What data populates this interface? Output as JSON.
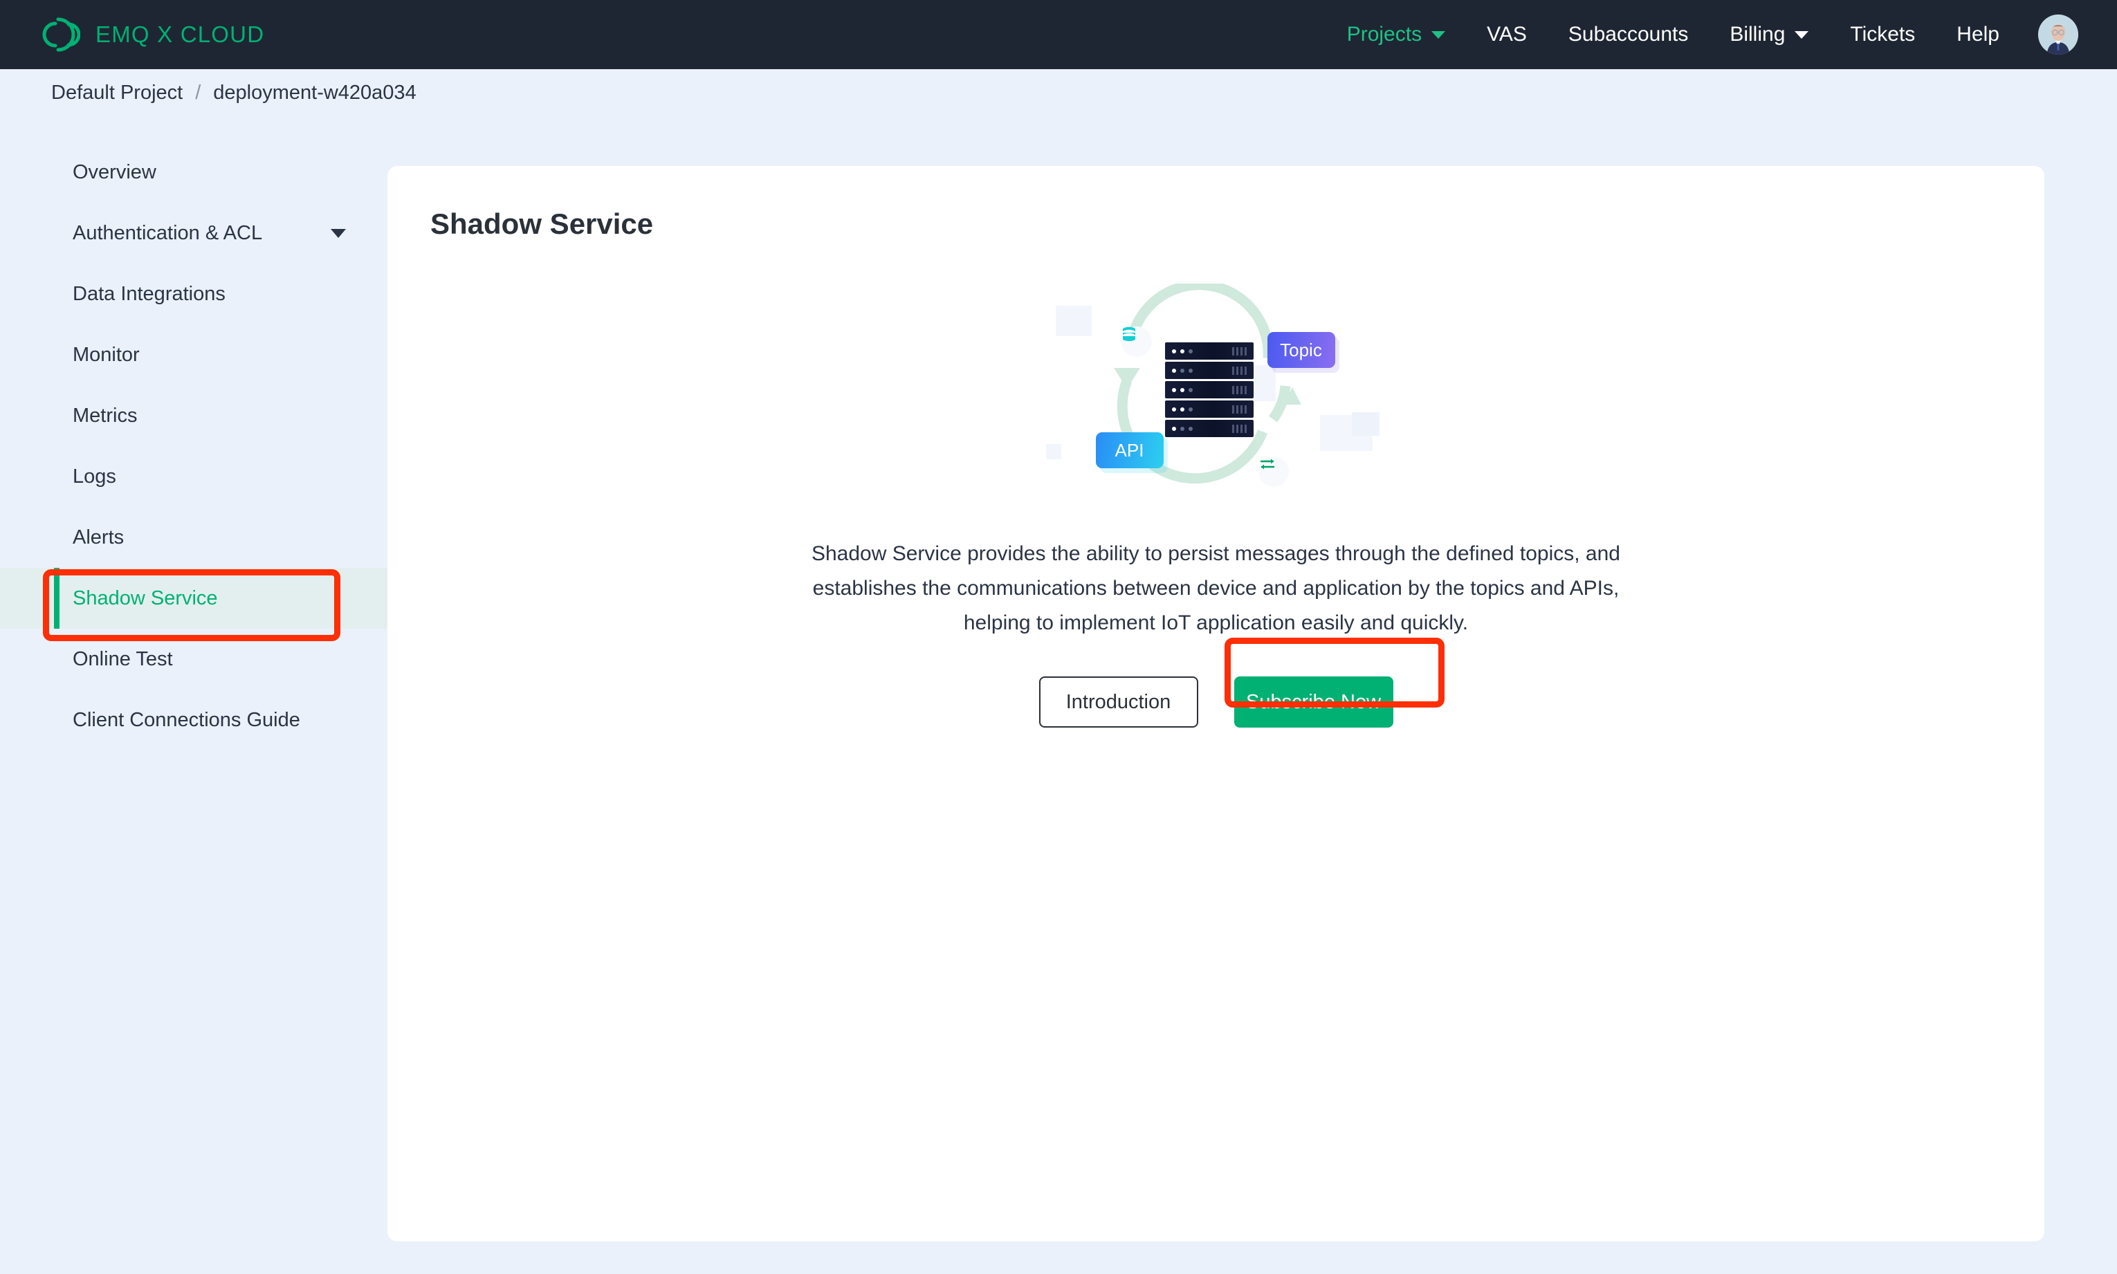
{
  "brand": {
    "name": "EMQ X CLOUD",
    "logo_icon": "emqx-arcs-logo",
    "color": "#00b173"
  },
  "topnav": {
    "items": [
      {
        "label": "Projects",
        "active": true,
        "has_caret": true,
        "icon": "chevron-down-icon"
      },
      {
        "label": "VAS",
        "active": false,
        "has_caret": false
      },
      {
        "label": "Subaccounts",
        "active": false,
        "has_caret": false
      },
      {
        "label": "Billing",
        "active": false,
        "has_caret": true,
        "icon": "chevron-down-icon"
      },
      {
        "label": "Tickets",
        "active": false,
        "has_caret": false
      },
      {
        "label": "Help",
        "active": false,
        "has_caret": false
      }
    ],
    "avatar_icon": "user-avatar",
    "background": "#1f2633"
  },
  "breadcrumb": {
    "project": "Default Project",
    "separator": "/",
    "current": "deployment-w420a034"
  },
  "sidebar": {
    "items": [
      {
        "label": "Overview",
        "active": false,
        "caret": false
      },
      {
        "label": "Authentication & ACL",
        "active": false,
        "caret": true
      },
      {
        "label": "Data Integrations",
        "active": false,
        "caret": false
      },
      {
        "label": "Monitor",
        "active": false,
        "caret": false
      },
      {
        "label": "Metrics",
        "active": false,
        "caret": false
      },
      {
        "label": "Logs",
        "active": false,
        "caret": false
      },
      {
        "label": "Alerts",
        "active": false,
        "caret": false
      },
      {
        "label": "Shadow Service",
        "active": true,
        "caret": false
      },
      {
        "label": "Online Test",
        "active": false,
        "caret": false
      },
      {
        "label": "Client Connections Guide",
        "active": false,
        "caret": false
      }
    ],
    "active_color": "#00b173",
    "active_background": "#e3efee"
  },
  "main": {
    "title": "Shadow Service",
    "description": "Shadow Service provides the ability to persist messages through the defined topics, and establishes the communications between device and application by the topics and APIs, helping to implement IoT application easily and quickly.",
    "buttons": {
      "introduction": "Introduction",
      "subscribe": "Subscribe Now"
    },
    "primary_color": "#00b173"
  },
  "illustration": {
    "topic_label": "Topic",
    "api_label": "API",
    "database_icon": "database-icon",
    "exchange_icon": "exchange-arrows-icon",
    "server_icon": "server-stack-icon",
    "server_rows": 5,
    "loop_color": "#cfe9dd",
    "topic_gradient": [
      "#4a5af0",
      "#8a6ef0"
    ],
    "api_gradient": [
      "#2a8df6",
      "#2ccff0"
    ]
  },
  "annotations": {
    "color": "#fc2f06",
    "boxes": [
      {
        "target": "sidebar-item-shadow-service"
      },
      {
        "target": "subscribe-now-button"
      }
    ]
  }
}
